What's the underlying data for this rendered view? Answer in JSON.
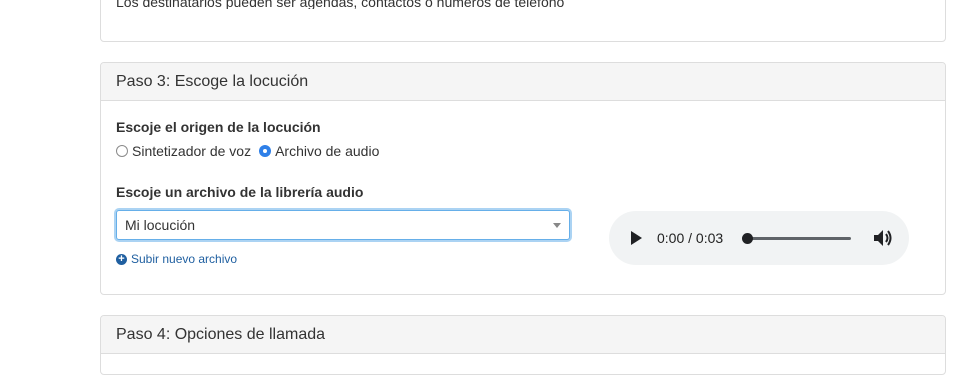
{
  "step2": {
    "help_text": "Los destinatarios pueden ser agendas, contactos o números de teléfono"
  },
  "step3": {
    "title": "Paso 3: Escoge la locución",
    "origin_label": "Escoje el origen de la locución",
    "origin_options": [
      {
        "label": "Sintetizador de voz",
        "selected": false
      },
      {
        "label": "Archivo de audio",
        "selected": true
      }
    ],
    "file_label": "Escoje un archivo de la librería audio",
    "file_select_value": "Mi locución",
    "upload_link": "Subir nuevo archivo",
    "player": {
      "time": "0:00 / 0:03",
      "progress": 0,
      "icons": [
        "play-icon",
        "volume-icon"
      ]
    }
  },
  "step4": {
    "title": "Paso 4: Opciones de llamada"
  },
  "colors": {
    "focus": "#66afe9",
    "radio_checked": "#2f80e8",
    "link": "#1f5fa0",
    "panel_heading_bg": "#f5f5f5"
  }
}
